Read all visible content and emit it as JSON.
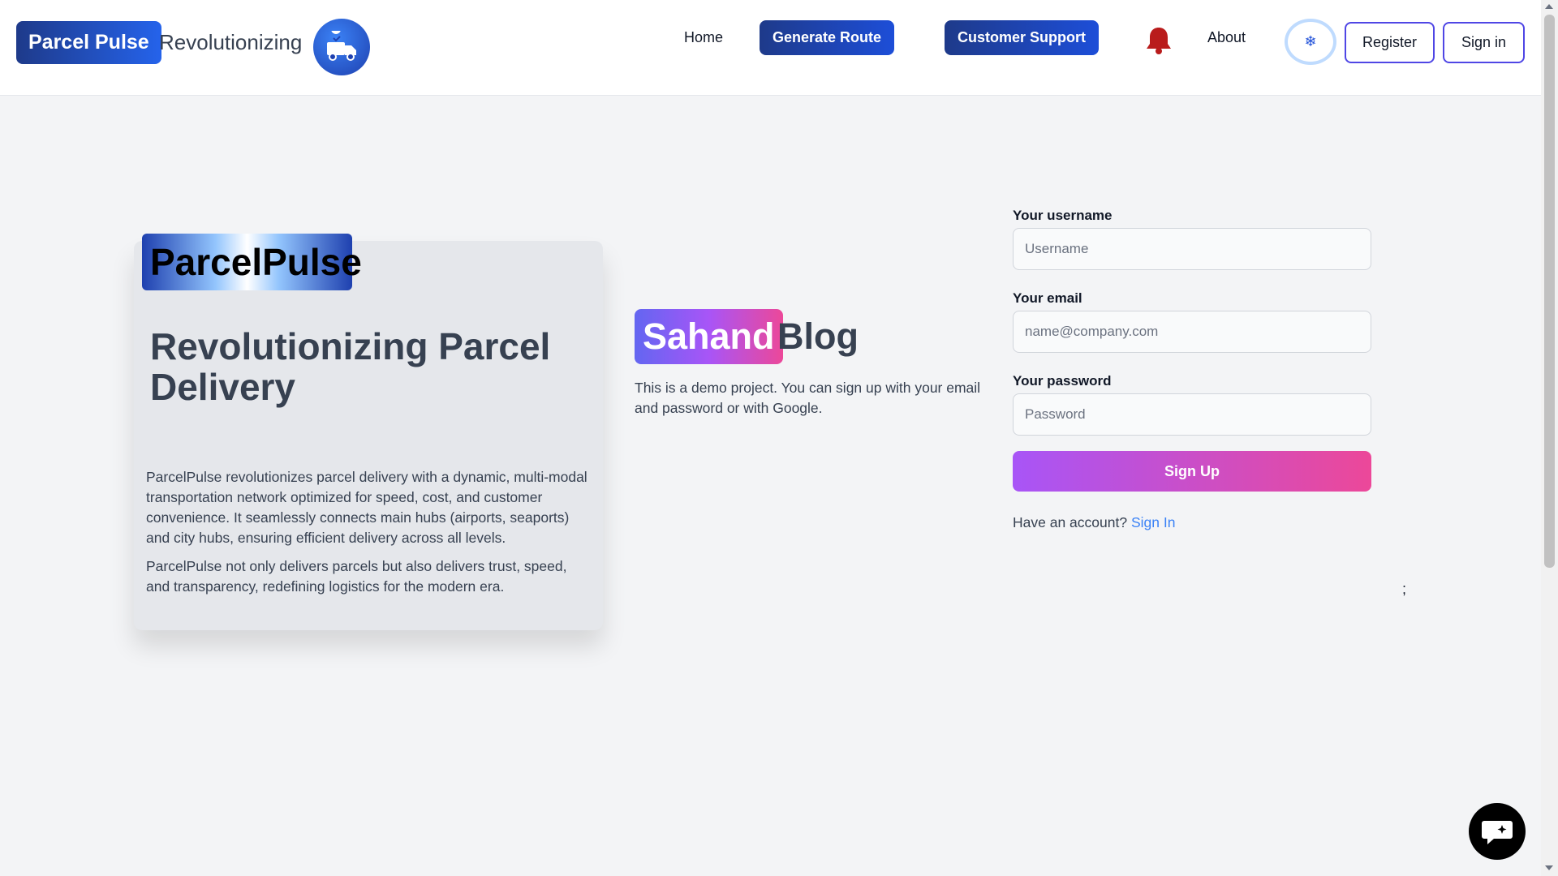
{
  "header": {
    "brand_name": "Parcel Pulse",
    "tagline": "Revolutionizing",
    "logo_icon": "delivery-truck-icon",
    "nav": {
      "home": "Home",
      "generate_route": "Generate Route",
      "customer_support": "Customer Support",
      "about": "About"
    },
    "notification_icon": "bell-icon",
    "theme_toggle_icon": "sun-icon",
    "theme_toggle_glyph": "❄",
    "register_label": "Register",
    "signin_label": "Sign in"
  },
  "hero": {
    "badge": "ParcelPulse",
    "title": "Revolutionizing Parcel Delivery",
    "paragraph1": "ParcelPulse revolutionizes parcel delivery with a dynamic, multi-modal transportation network optimized for speed, cost, and customer convenience. It seamlessly connects main hubs (airports, seaports) and city hubs, ensuring efficient delivery across all levels.",
    "paragraph2": "ParcelPulse not only delivers parcels but also delivers trust, speed, and transparency, redefining logistics for the modern era."
  },
  "blog": {
    "highlight": "Sahand",
    "word": "Blog",
    "description": "This is a demo project. You can sign up with your email and password or with Google."
  },
  "form": {
    "username_label": "Your username",
    "username_placeholder": "Username",
    "username_value": "",
    "email_label": "Your email",
    "email_placeholder": "name@company.com",
    "email_value": "",
    "password_label": "Your password",
    "password_placeholder": "Password",
    "password_value": "",
    "submit_label": "Sign Up",
    "have_account": "Have an account?",
    "signin_link": "Sign In"
  },
  "stray_text": ";",
  "chat_icon": "chat-bubble-icon",
  "colors": {
    "brand_blue": "#1e3a8a",
    "accent_purple": "#a855f7",
    "accent_pink": "#ec4899",
    "link_blue": "#3b82f6",
    "bell_red": "#b91c1c"
  }
}
